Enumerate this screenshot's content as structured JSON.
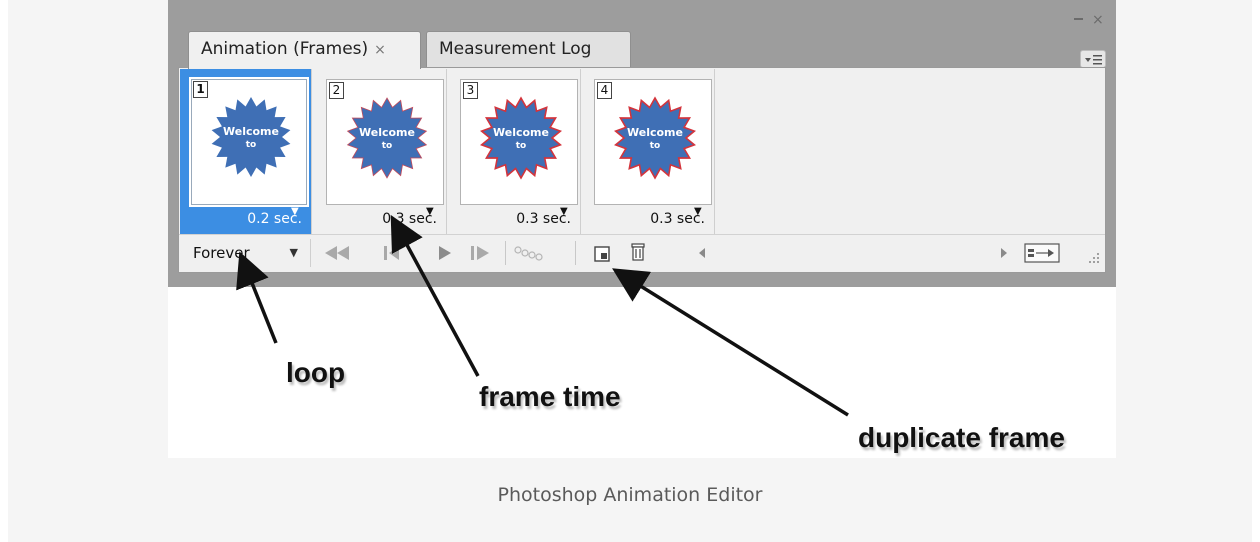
{
  "panel": {
    "tabs": [
      {
        "label": "Animation (Frames)",
        "close": "×"
      },
      {
        "label": "Measurement Log"
      }
    ],
    "window_close": "×"
  },
  "frames": [
    {
      "number": "1",
      "time": "0.2 sec.",
      "selected": true,
      "thumb_text_1": "Welcome",
      "thumb_text_2": "to"
    },
    {
      "number": "2",
      "time": "0.3 sec.",
      "selected": false,
      "thumb_text_1": "Welcome",
      "thumb_text_2": "to"
    },
    {
      "number": "3",
      "time": "0.3 sec.",
      "selected": false,
      "thumb_text_1": "Welcome",
      "thumb_text_2": "to"
    },
    {
      "number": "4",
      "time": "0.3 sec.",
      "selected": false,
      "thumb_text_1": "Welcome",
      "thumb_text_2": "to"
    }
  ],
  "bottombar": {
    "loop_value": "Forever"
  },
  "annotations": {
    "loop": "loop",
    "frame_time": "frame time",
    "duplicate_frame": "duplicate frame"
  },
  "caption": "Photoshop Animation Editor",
  "colors": {
    "selected": "#3c8ee3",
    "star_fill": "#3f6fb5",
    "star_outline_red": "#d3343c"
  }
}
